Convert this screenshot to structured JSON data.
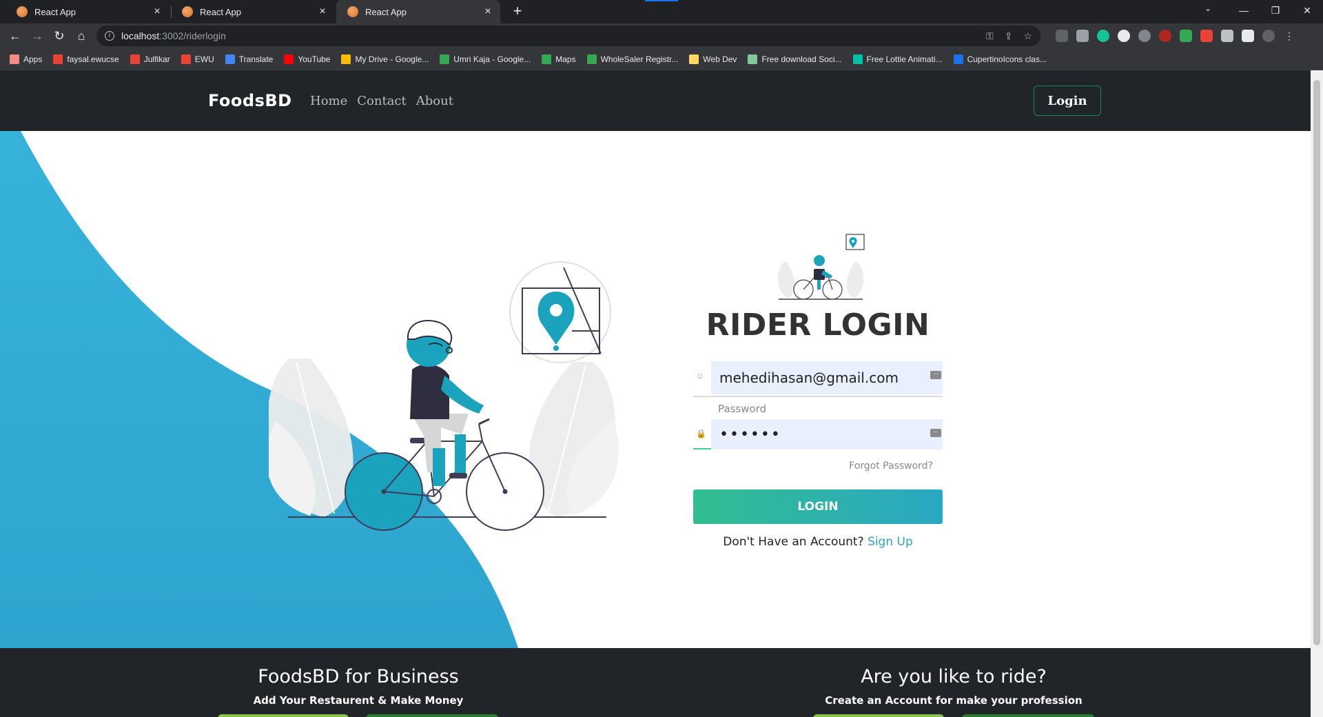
{
  "browser": {
    "tabs": [
      {
        "title": "React App",
        "active": false
      },
      {
        "title": "React App",
        "active": false
      },
      {
        "title": "React App",
        "active": true
      }
    ],
    "url_host": "localhost",
    "url_path": ":3002/riderlogin",
    "bookmarks": [
      {
        "label": "Apps",
        "color": "#f28b82"
      },
      {
        "label": "faysal.ewucse",
        "color": "#ea4335"
      },
      {
        "label": "Julfikar",
        "color": "#ea4335"
      },
      {
        "label": "EWU",
        "color": "#ea4335"
      },
      {
        "label": "Translate",
        "color": "#4285f4"
      },
      {
        "label": "YouTube",
        "color": "#ff0000"
      },
      {
        "label": "My Drive - Google...",
        "color": "#fbbc04"
      },
      {
        "label": "Umri Kaja - Google...",
        "color": "#34a853"
      },
      {
        "label": "Maps",
        "color": "#34a853"
      },
      {
        "label": "WholeSaler Registr...",
        "color": "#34a853"
      },
      {
        "label": "Web Dev",
        "color": "#fdd663"
      },
      {
        "label": "Free download Soci...",
        "color": "#81c995"
      },
      {
        "label": "Free Lottie Animati...",
        "color": "#00c2a8"
      },
      {
        "label": "CupertinoIcons clas...",
        "color": "#1a73e8"
      }
    ]
  },
  "nav": {
    "brand": "FoodsBD",
    "links": [
      "Home",
      "Contact",
      "About"
    ],
    "login_label": "Login"
  },
  "login": {
    "title": "RIDER LOGIN",
    "email_value": "mehedihasan@gmail.com",
    "password_label": "Password",
    "password_value": "••••••",
    "forgot": "Forgot Password?",
    "button": "LOGIN",
    "no_account": "Don't Have an Account?",
    "signup": "Sign Up"
  },
  "footer": {
    "business_title": "FoodsBD for Business",
    "business_sub": "Add Your Restaurent & Make Money",
    "ride_title": "Are you like to ride?",
    "ride_sub": "Create an Account for make your profession"
  },
  "colors": {
    "accent_blue": "#2aa7c4",
    "accent_green": "#32be8f",
    "dark": "#212529"
  }
}
